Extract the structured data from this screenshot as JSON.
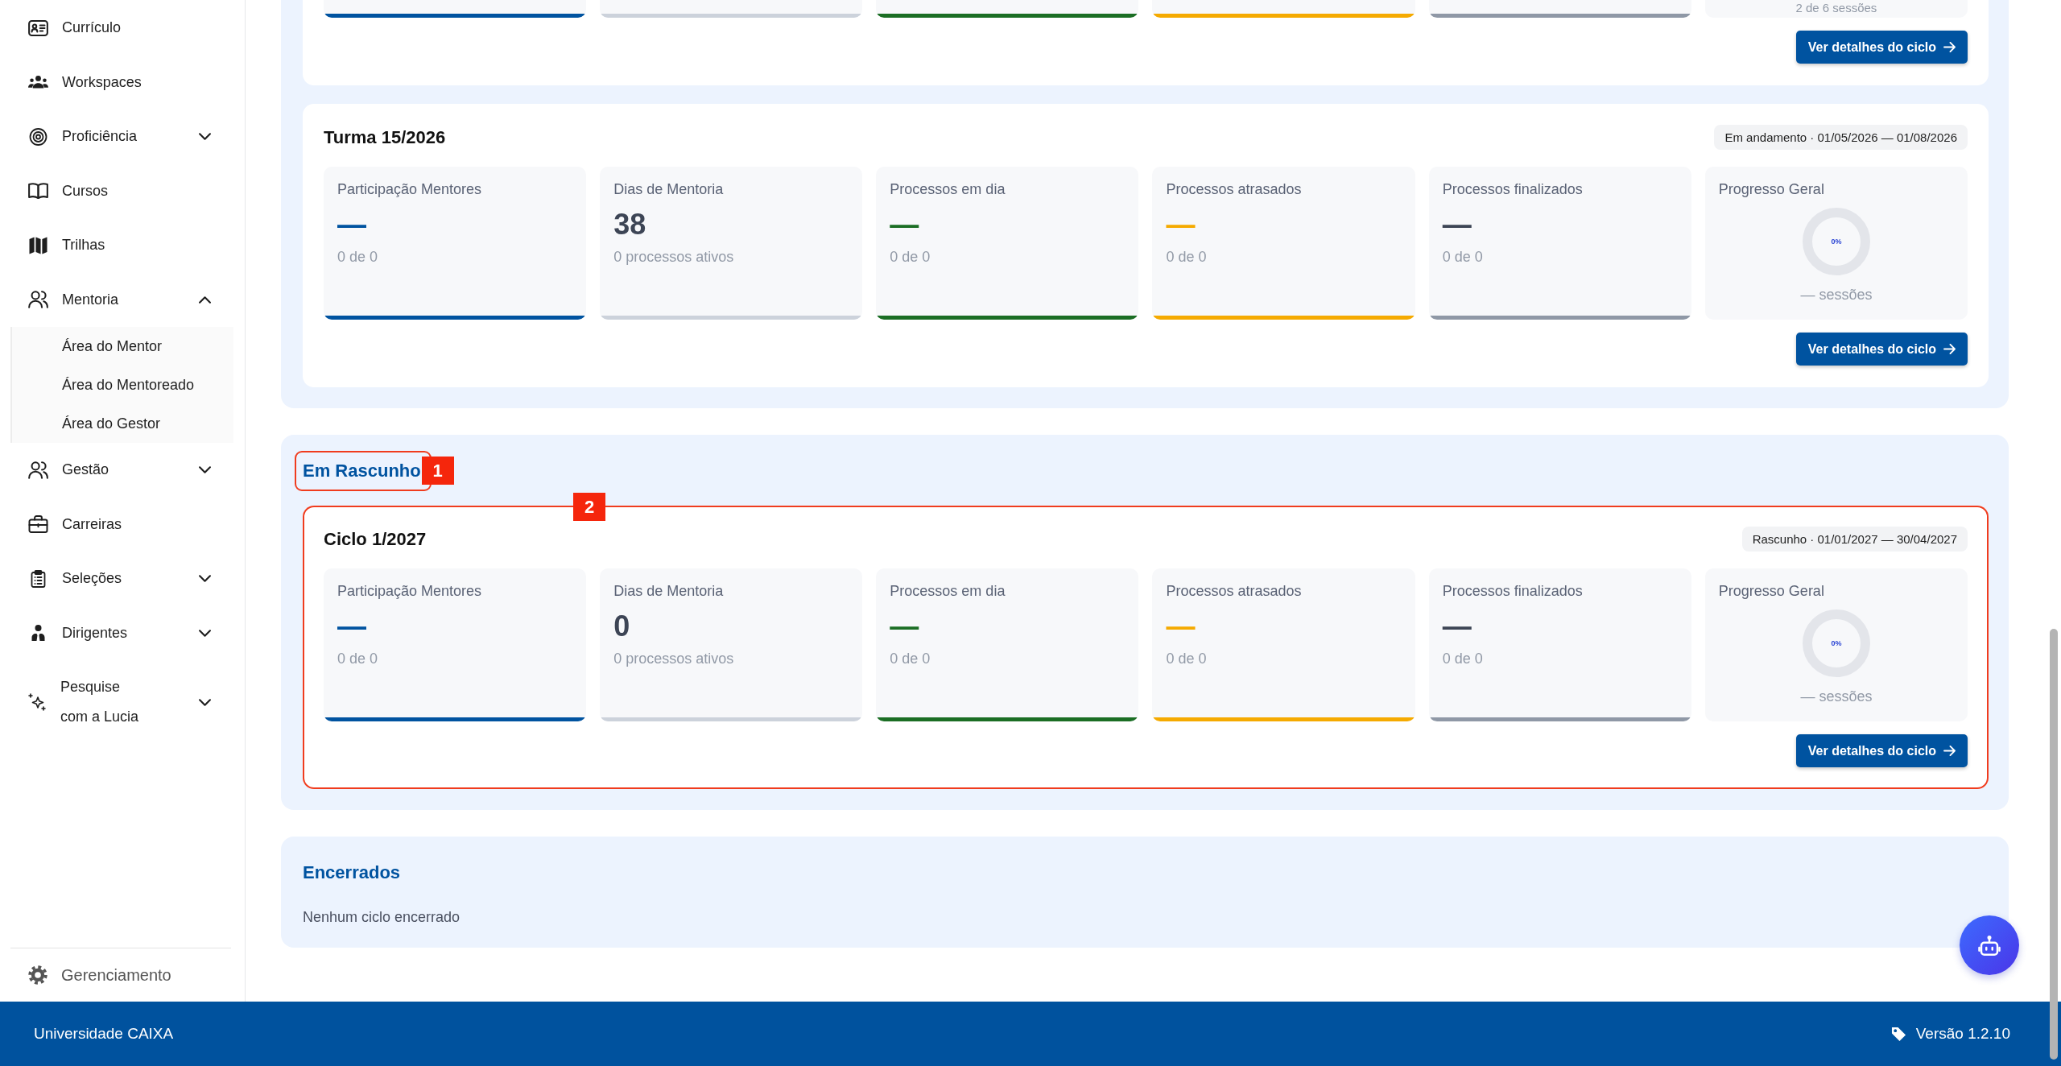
{
  "sidebar": {
    "items": [
      {
        "kind": "link",
        "label": "Currículo"
      },
      {
        "kind": "link",
        "label": "Workspaces"
      },
      {
        "kind": "group",
        "label": "Proficiência",
        "expanded": false
      },
      {
        "kind": "link",
        "label": "Cursos"
      },
      {
        "kind": "link",
        "label": "Trilhas"
      },
      {
        "kind": "group",
        "label": "Mentoria",
        "expanded": true,
        "children": [
          {
            "label": "Área do Mentor"
          },
          {
            "label": "Área do Mentoreado"
          },
          {
            "label": "Área do Gestor"
          }
        ]
      },
      {
        "kind": "group",
        "label": "Gestão",
        "expanded": false
      },
      {
        "kind": "link",
        "label": "Carreiras"
      },
      {
        "kind": "group",
        "label": "Seleções",
        "expanded": false
      },
      {
        "kind": "group",
        "label": "Dirigentes",
        "expanded": false
      },
      {
        "kind": "group",
        "label": "Pesquise com a Lucia",
        "expanded": false
      }
    ],
    "footer_item": {
      "label": "Gerenciamento"
    }
  },
  "sections": [
    {
      "cycles": [
        {
          "tiles": [
            {
              "kind": "metric",
              "color": "#0053a0"
            },
            {
              "kind": "neutral",
              "color": "#ccd2db"
            },
            {
              "kind": "metric",
              "color": "#1b6e24"
            },
            {
              "kind": "metric",
              "color": "#f5aa00"
            },
            {
              "kind": "neutral",
              "color": "#8f98a6"
            },
            {
              "kind": "progress",
              "sessions": "2 de 6 sessões"
            }
          ],
          "button": "Ver detalhes do ciclo"
        },
        {
          "title": "Turma 15/2026",
          "status": "Em andamento · 01/05/2026 — 01/08/2026",
          "tiles": [
            {
              "kind": "metric",
              "label": "Participação Mentores",
              "value": "—",
              "detail": "0 de 0",
              "color": "#0053a0"
            },
            {
              "kind": "neutral",
              "label": "Dias de Mentoria",
              "value": "38",
              "detail": "0 processos ativos",
              "color": "#ccd2db"
            },
            {
              "kind": "metric",
              "label": "Processos em dia",
              "value": "—",
              "detail": "0 de 0",
              "color": "#1b6e24"
            },
            {
              "kind": "metric",
              "label": "Processos atrasados",
              "value": "—",
              "detail": "0 de 0",
              "color": "#f5aa00"
            },
            {
              "kind": "neutral",
              "label": "Processos finalizados",
              "value": "—",
              "detail": "0 de 0",
              "color": "#8f98a6"
            },
            {
              "kind": "progress",
              "label": "Progresso Geral",
              "percent": "0%",
              "level": 0,
              "sessions": "— sessões"
            }
          ],
          "button": "Ver detalhes do ciclo"
        }
      ]
    },
    {
      "title": "Em Rascunho",
      "title_marker": "1",
      "cycles": [
        {
          "title": "Ciclo 1/2027",
          "marker": "2",
          "status": "Rascunho · 01/01/2027 — 30/04/2027",
          "tiles": [
            {
              "kind": "metric",
              "label": "Participação Mentores",
              "value": "—",
              "detail": "0 de 0",
              "color": "#0053a0"
            },
            {
              "kind": "neutral",
              "label": "Dias de Mentoria",
              "value": "0",
              "detail": "0 processos ativos",
              "color": "#ccd2db"
            },
            {
              "kind": "metric",
              "label": "Processos em dia",
              "value": "—",
              "detail": "0 de 0",
              "color": "#1b6e24"
            },
            {
              "kind": "metric",
              "label": "Processos atrasados",
              "value": "—",
              "detail": "0 de 0",
              "color": "#f5aa00"
            },
            {
              "kind": "neutral",
              "label": "Processos finalizados",
              "value": "—",
              "detail": "0 de 0",
              "color": "#8f98a6"
            },
            {
              "kind": "progress",
              "label": "Progresso Geral",
              "percent": "0%",
              "level": 0,
              "sessions": "— sessões"
            }
          ],
          "button": "Ver detalhes do ciclo"
        }
      ]
    },
    {
      "title": "Encerrados",
      "empty_text": "Nenhum ciclo encerrado"
    }
  ],
  "footer": {
    "brand": "Universidade CAIXA",
    "version": "Versão 1.2.10"
  }
}
